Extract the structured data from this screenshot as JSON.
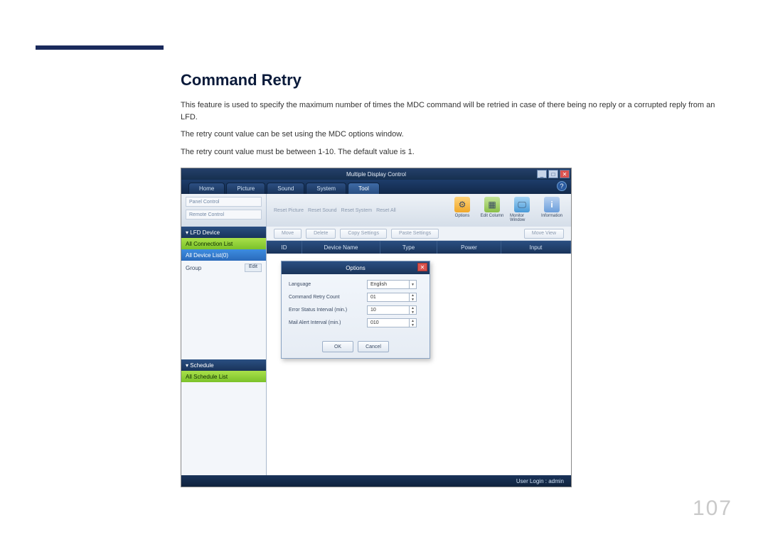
{
  "heading": "Command Retry",
  "paragraphs": {
    "p1": "This feature is used to specify the maximum number of times the MDC command will be retried in case of there being no reply or a corrupted reply from an LFD.",
    "p2": "The retry count value can be set using the MDC options window.",
    "p3": "The retry count value must be between 1-10. The default value is 1."
  },
  "page_number": "107",
  "app": {
    "title": "Multiple Display Control",
    "tabs": {
      "home": "Home",
      "picture": "Picture",
      "sound": "Sound",
      "system": "System",
      "tool": "Tool"
    },
    "help": "?",
    "toolbar_left": {
      "panel_control": "Panel Control",
      "remote_control": "Remote Control"
    },
    "toolbar_mid": {
      "reset_picture": "Reset Picture",
      "reset_sound": "Reset Sound",
      "reset_system": "Reset System",
      "reset_all": "Reset All"
    },
    "toolbar_right": {
      "options": "Options",
      "edit_column": "Edit Column",
      "monitor_window": "Monitor Window",
      "information": "Information"
    },
    "sidebar": {
      "lfd_device": "▾  LFD Device",
      "all_connection_list": "All Connection List",
      "all_device_list": "All Device List(0)",
      "group": "Group",
      "edit": "Edit",
      "schedule": "▾  Schedule",
      "all_schedule_list": "All Schedule List"
    },
    "btn_row": {
      "move": "Move",
      "delete": "Delete",
      "copy_settings": "Copy Settings",
      "paste_settings": "Paste Settings",
      "move_view": "Move View"
    },
    "columns": {
      "id": "ID",
      "device_name": "Device Name",
      "type": "Type",
      "power": "Power",
      "input": "Input"
    },
    "dialog": {
      "title": "Options",
      "language_label": "Language",
      "language_value": "English",
      "retry_label": "Command Retry Count",
      "retry_value": "01",
      "error_label": "Error Status Interval (min.)",
      "error_value": "10",
      "mail_label": "Mail Alert Interval (min.)",
      "mail_value": "010",
      "ok": "OK",
      "cancel": "Cancel"
    },
    "statusbar": "User Login : admin"
  }
}
